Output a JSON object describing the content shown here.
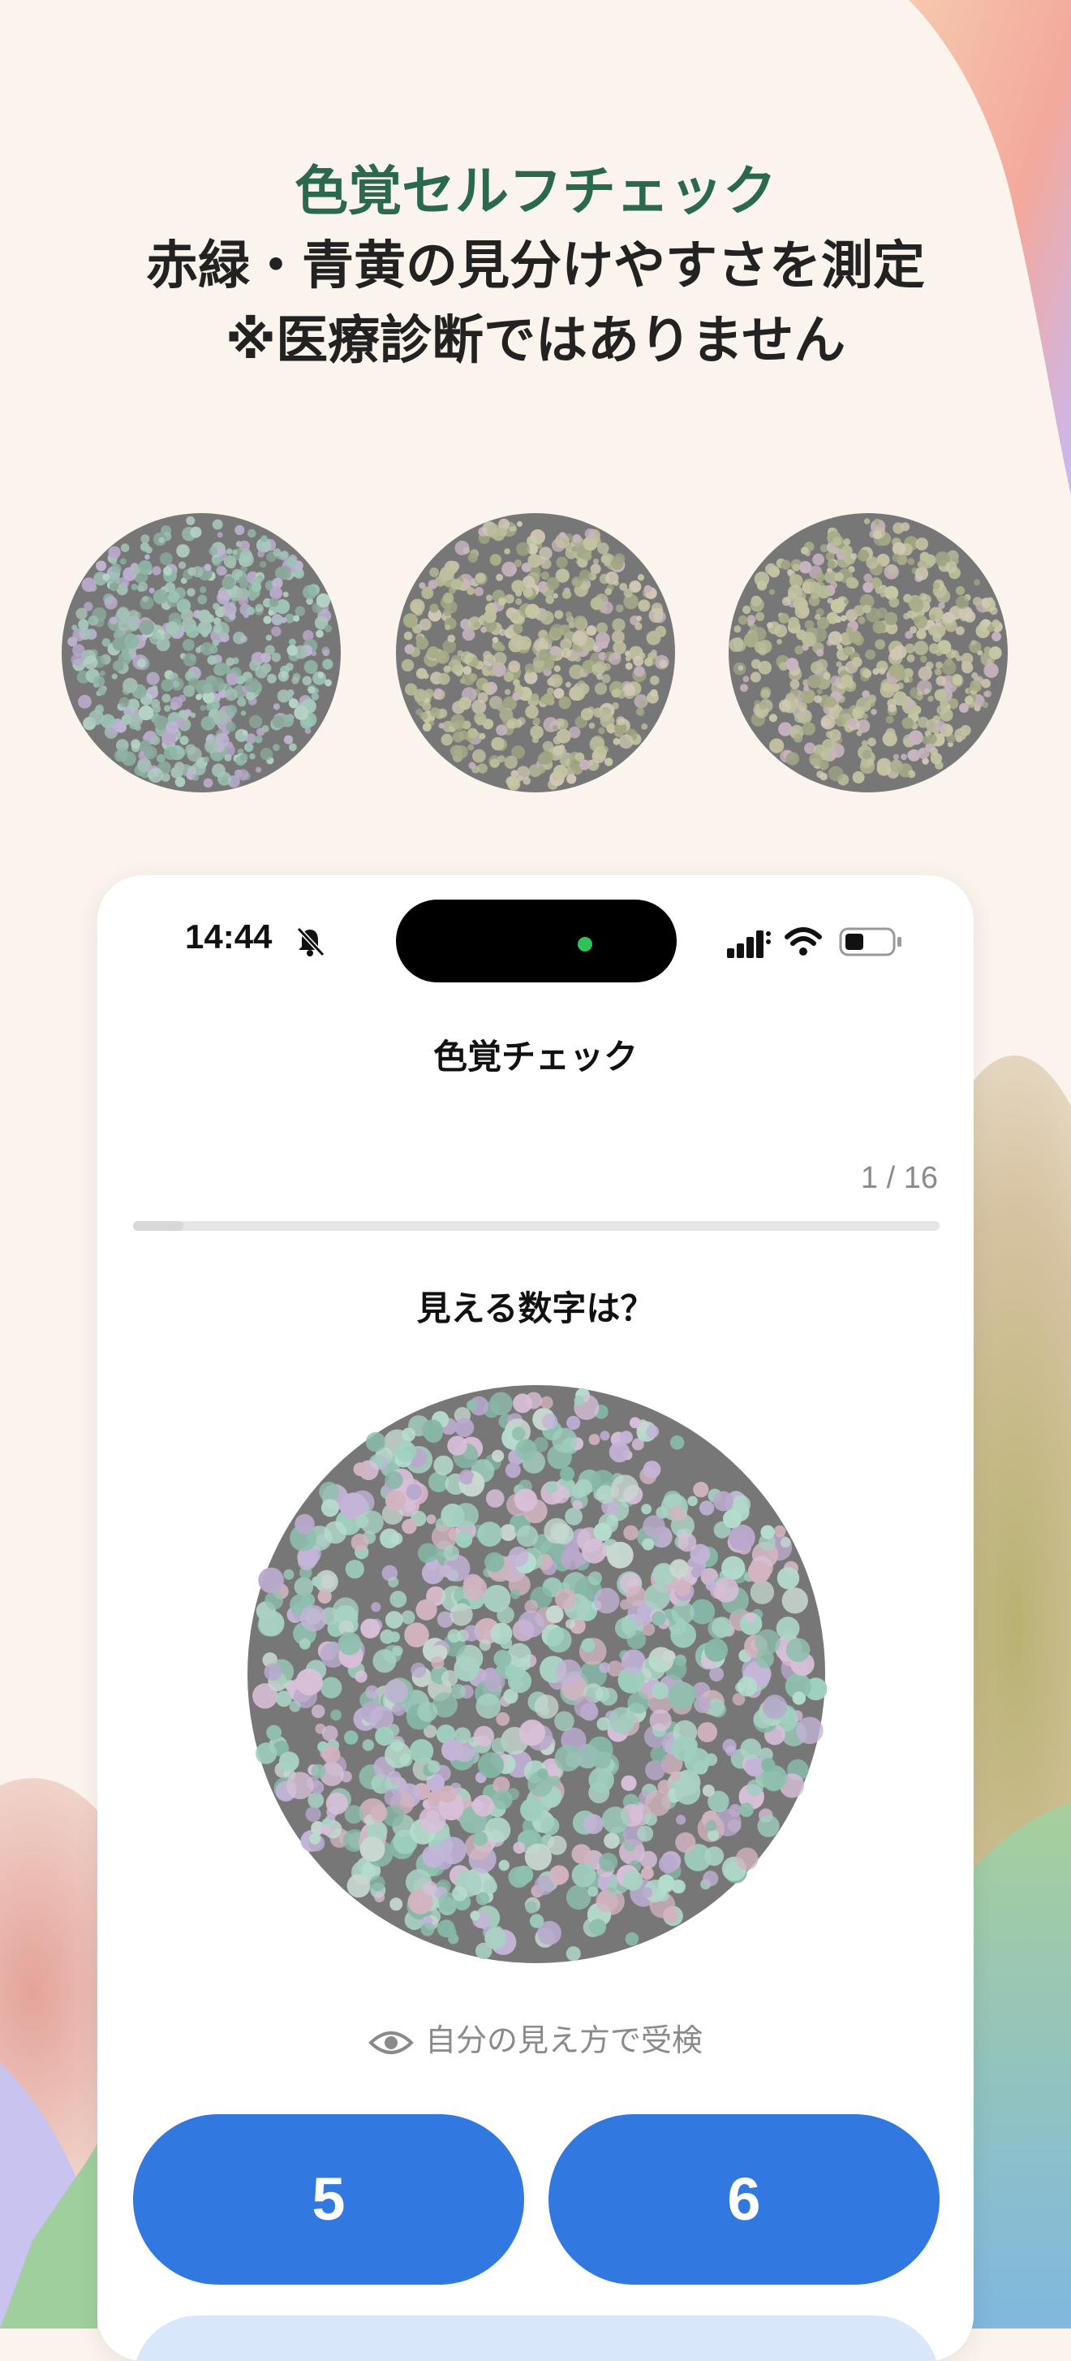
{
  "marketing": {
    "title": "色覚セルフチェック",
    "line2": "赤緑・青黄の見分けやすさを測定",
    "line3": "※医療診断ではありません"
  },
  "preview_plates": [
    {
      "label": "plate-1",
      "tint": "green-teal"
    },
    {
      "label": "plate-2",
      "tint": "olive-yellow"
    },
    {
      "label": "plate-3",
      "tint": "olive-yellow"
    }
  ],
  "status_bar": {
    "time": "14:44",
    "silent_icon": "bell-slash-icon",
    "signal_icon": "cellular-signal-icon",
    "wifi_icon": "wifi-icon",
    "battery_icon": "battery-icon"
  },
  "screen": {
    "title": "色覚チェック",
    "progress_text": "1 / 16",
    "progress_fraction": 0.0625,
    "question": "見える数字は？",
    "mode_label": "自分の見え方で受検",
    "answers": [
      "5",
      "6"
    ]
  },
  "colors": {
    "accent": "#3178e0",
    "title_green": "#2a6a4a",
    "plate_gray": "#777777"
  }
}
